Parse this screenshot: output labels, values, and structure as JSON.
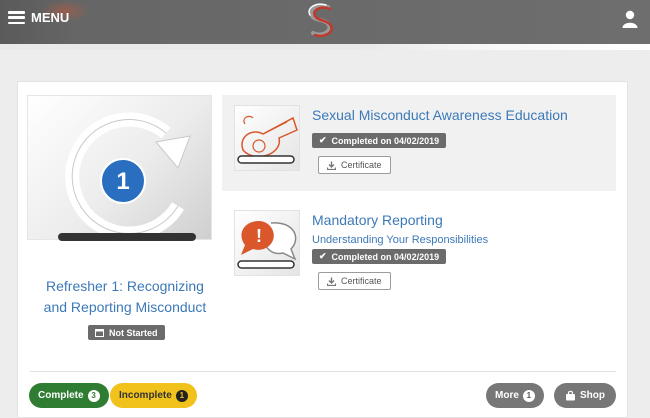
{
  "header": {
    "menu_label": "MENU"
  },
  "featured": {
    "number": "1",
    "title_line1": "Refresher 1: Recognizing",
    "title_line2": "and Reporting Misconduct",
    "status": "Not Started"
  },
  "courses": [
    {
      "title": "Sexual Misconduct Awareness Education",
      "subtitle": "",
      "status": "Completed on 04/02/2019",
      "certificate_label": "Certificate",
      "icon": "whistle-icon"
    },
    {
      "title": "Mandatory Reporting",
      "subtitle": "Understanding Your Responsibilities",
      "status": "Completed on 04/02/2019",
      "certificate_label": "Certificate",
      "icon": "speech-bubbles-icon"
    }
  ],
  "filters": {
    "complete": {
      "label": "Complete",
      "count": "3"
    },
    "incomplete": {
      "label": "Incomplete",
      "count": "1"
    },
    "more": {
      "label": "More",
      "count": "1"
    },
    "shop": {
      "label": "Shop"
    }
  },
  "colors": {
    "header_bg": "#666666",
    "link_blue": "#3c79b8",
    "badge_gray": "#6b6b6b",
    "complete_green": "#2e7d32",
    "incomplete_yellow": "#f1c21b",
    "alert_orange": "#d9572b"
  }
}
